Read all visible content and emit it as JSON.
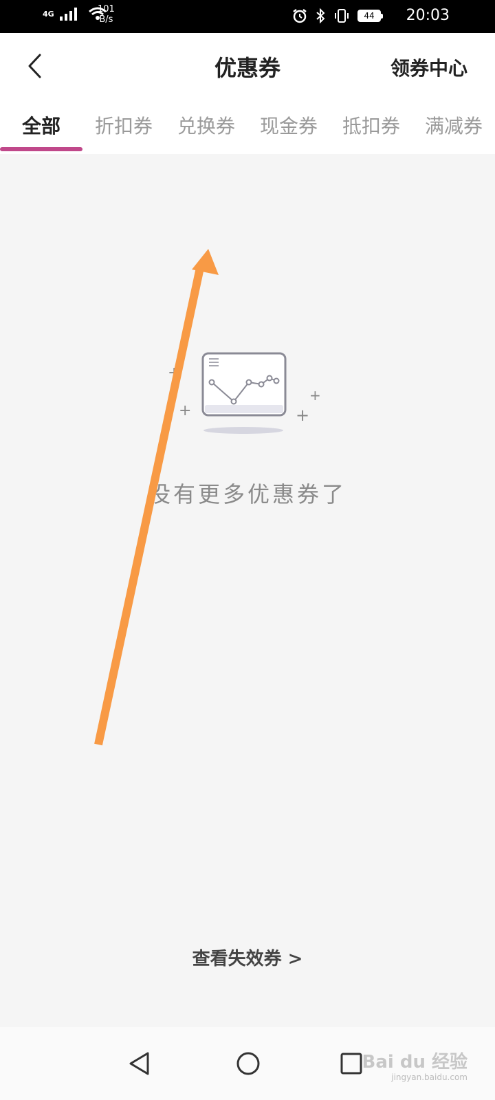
{
  "status_bar": {
    "network_type": "4G",
    "speed_value": "101",
    "speed_unit": "B/s",
    "battery": "44",
    "time": "20:03",
    "icons": [
      "signal-icon",
      "wifi-icon",
      "alarm-icon",
      "bluetooth-icon",
      "vibrate-icon",
      "battery-icon"
    ]
  },
  "header": {
    "title": "优惠券",
    "right_link": "领券中心",
    "back_icon": "chevron-left-icon"
  },
  "tabs": [
    {
      "label": "全部",
      "active": true
    },
    {
      "label": "折扣券",
      "active": false
    },
    {
      "label": "兑换券",
      "active": false
    },
    {
      "label": "现金券",
      "active": false
    },
    {
      "label": "抵扣券",
      "active": false
    },
    {
      "label": "满减券",
      "active": false
    }
  ],
  "empty_state": {
    "icon": "empty-chart-icon",
    "message": "没有更多优惠券了"
  },
  "footer_link": "查看失效券 >",
  "nav_bar": {
    "icons": [
      "nav-back-icon",
      "nav-home-icon",
      "nav-recents-icon"
    ]
  },
  "watermark": {
    "brand": "Bai du 经验",
    "url": "jingyan.baidu.com"
  },
  "colors": {
    "tab_indicator": "#c0488a",
    "annotation_arrow": "#f89a45",
    "background": "#f5f5f5"
  }
}
